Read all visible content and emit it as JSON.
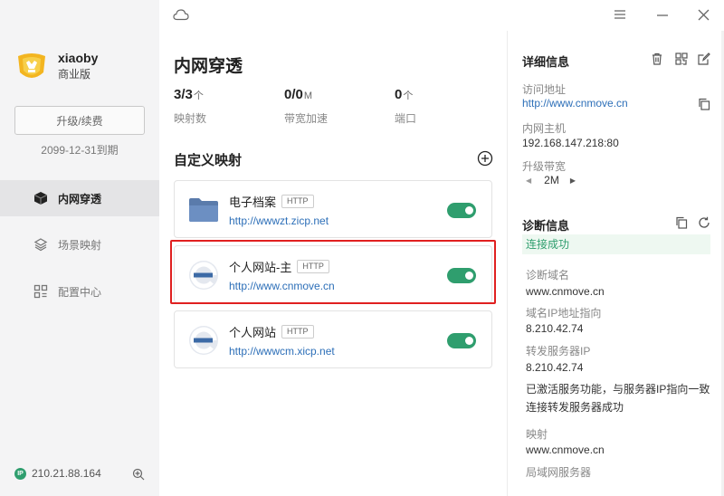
{
  "sidebar": {
    "username": "xiaoby",
    "edition": "商业版",
    "upgrade_label": "升级/续费",
    "expire": "2099-12-31到期",
    "nav": [
      {
        "label": "内网穿透",
        "icon": "cube-icon",
        "active": true
      },
      {
        "label": "场景映射",
        "icon": "layers-icon",
        "active": false
      },
      {
        "label": "配置中心",
        "icon": "grid-icon",
        "active": false
      }
    ],
    "ip_badge": "IP",
    "ip": "210.21.88.164"
  },
  "main": {
    "title": "内网穿透",
    "stats": [
      {
        "value": "3/3",
        "unit": "个",
        "label": "映射数"
      },
      {
        "value": "0/0",
        "unit": "M",
        "label": "带宽加速"
      },
      {
        "value": "0",
        "unit": "个",
        "label": "端口"
      }
    ],
    "section_title": "自定义映射",
    "mappings": [
      {
        "name": "电子档案",
        "tag": "HTTP",
        "url": "http://wwwzt.zicp.net",
        "icon": "folder-icon",
        "enabled": true
      },
      {
        "name": "个人网站-主",
        "tag": "HTTP",
        "url": "http://www.cnmove.cn",
        "icon": "browser-e-icon",
        "enabled": true,
        "highlighted": true
      },
      {
        "name": "个人网站",
        "tag": "HTTP",
        "url": "http://wwwcm.xicp.net",
        "icon": "browser-e-icon",
        "enabled": true
      }
    ]
  },
  "details": {
    "title": "详细信息",
    "access_label": "访问地址",
    "access_url": "http://www.cnmove.cn",
    "host_label": "内网主机",
    "host_value": "192.168.147.218:80",
    "bandwidth_label": "升级带宽",
    "bandwidth_value": "2M"
  },
  "diagnosis": {
    "title": "诊断信息",
    "status": "连接成功",
    "domain_label": "诊断域名",
    "domain_value": "www.cnmove.cn",
    "ip_label": "域名IP地址指向",
    "ip_value": "8.210.42.74",
    "forward_label": "转发服务器IP",
    "forward_value": "8.210.42.74",
    "message_line1": "已激活服务功能，与服务器IP指向一致",
    "message_line2": "连接转发服务器成功",
    "mapping_label": "映射",
    "mapping_value": "www.cnmove.cn",
    "lan_label": "局域网服务器"
  },
  "colors": {
    "accent_green": "#2f9e6e",
    "link_blue": "#2d6fb8",
    "highlight_red": "#e02020"
  }
}
